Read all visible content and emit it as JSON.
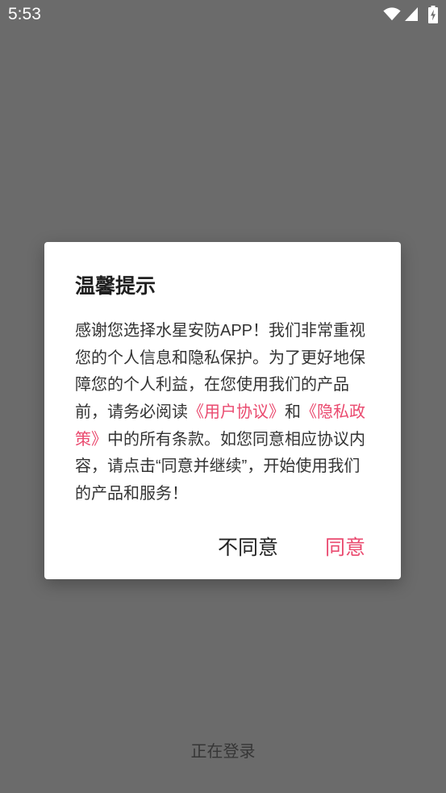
{
  "status_bar": {
    "time": "5:53",
    "icons": {
      "wifi": "wifi-icon",
      "signal": "cellular-signal-icon",
      "battery": "battery-charging-icon"
    }
  },
  "background": {
    "status_text": "正在登录"
  },
  "dialog": {
    "title": "温馨提示",
    "body_lines": [
      [
        "感谢您选择水星安防APP！我们非常重视"
      ],
      [
        "您的个人信息和隐私保护。为了更好地保"
      ],
      [
        "障您的个人利益，在您使用我们的产品"
      ],
      [
        "前，请务必阅读",
        "《用户协议》",
        "和",
        "《隐私政"
      ],
      [
        "策》",
        "中的所有条款。如您同意相应协议内"
      ],
      [
        "容，请点击“同意并继续”，开始使用我们"
      ],
      [
        "的产品和服务！"
      ]
    ],
    "buttons": {
      "decline": "不同意",
      "accept": "同意"
    }
  },
  "colors": {
    "accent": "#ea4a6f",
    "overlay": "#6b6b6b",
    "dialog_bg": "#ffffff",
    "text": "#333333",
    "status_fg": "#ffffff"
  }
}
